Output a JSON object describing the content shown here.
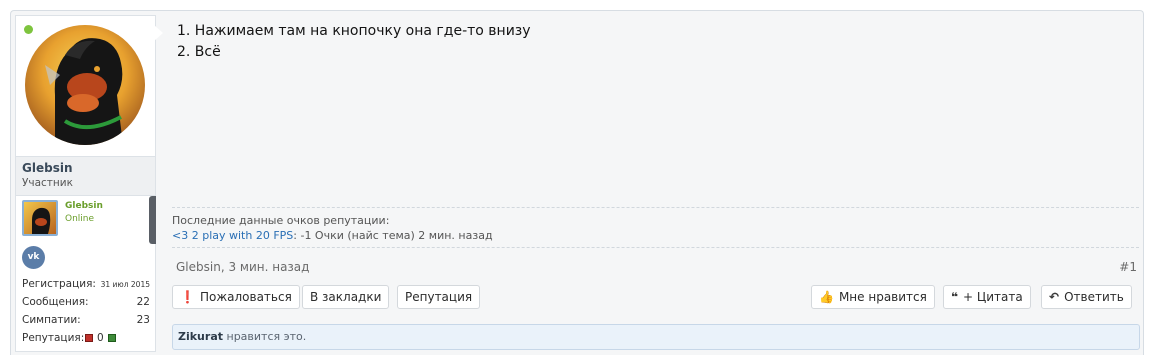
{
  "user": {
    "name": "Glebsin",
    "title": "Участник",
    "mini_name": "Glebsin",
    "mini_status": "Online",
    "social": "vk",
    "stats": [
      {
        "label": "Регистрация:",
        "value": "31 июл 2015"
      },
      {
        "label": "Сообщения:",
        "value": "22"
      },
      {
        "label": "Симпатии:",
        "value": "23"
      }
    ],
    "reputation": {
      "label": "Репутация:",
      "value": "0"
    }
  },
  "message": {
    "lines": [
      "1. Нажимаем там на кнопочку она где-то внизу",
      "2. Всё"
    ]
  },
  "reputation_info": {
    "heading": "Последние данные очков репутации:",
    "link_text": "<3 2 play with 20 FPS",
    "detail": ": -1 Очки (найс тема) 2 мин. назад"
  },
  "post_meta": {
    "author_time": "Glebsin, 3 мин. назад",
    "number": "#1"
  },
  "buttons": {
    "report": "Пожаловаться",
    "bookmark": "В закладки",
    "reputation": "Репутация",
    "like": "Мне нравится",
    "quote": "+ Цитата",
    "reply": "Ответить"
  },
  "likes": {
    "user": "Zikurat",
    "text": " нравится это."
  },
  "colors": {
    "online": "#7ec43e",
    "link": "#2a6fb5",
    "likes_bg": "#eaf2fa"
  }
}
